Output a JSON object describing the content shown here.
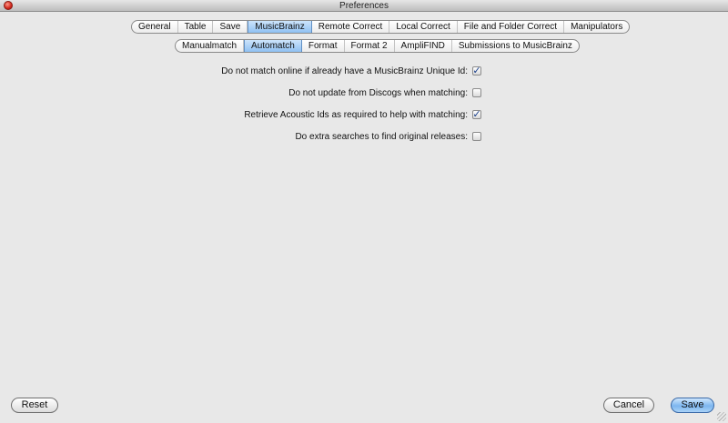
{
  "window": {
    "title": "Preferences"
  },
  "main_tabs": [
    "General",
    "Table",
    "Save",
    "MusicBrainz",
    "Remote Correct",
    "Local Correct",
    "File and Folder Correct",
    "Manipulators"
  ],
  "main_tabs_active": "MusicBrainz",
  "sub_tabs": [
    "Manualmatch",
    "Automatch",
    "Format",
    "Format 2",
    "AmpliFIND",
    "Submissions to MusicBrainz"
  ],
  "sub_tabs_active": "Automatch",
  "options": [
    {
      "label": "Do not match online if already have a MusicBrainz Unique Id:",
      "checked": true
    },
    {
      "label": "Do not update from Discogs when matching:",
      "checked": false
    },
    {
      "label": "Retrieve Acoustic Ids as required to help with matching:",
      "checked": true
    },
    {
      "label": "Do extra searches to find original releases:",
      "checked": false
    }
  ],
  "buttons": {
    "reset": "Reset",
    "cancel": "Cancel",
    "save": "Save"
  }
}
